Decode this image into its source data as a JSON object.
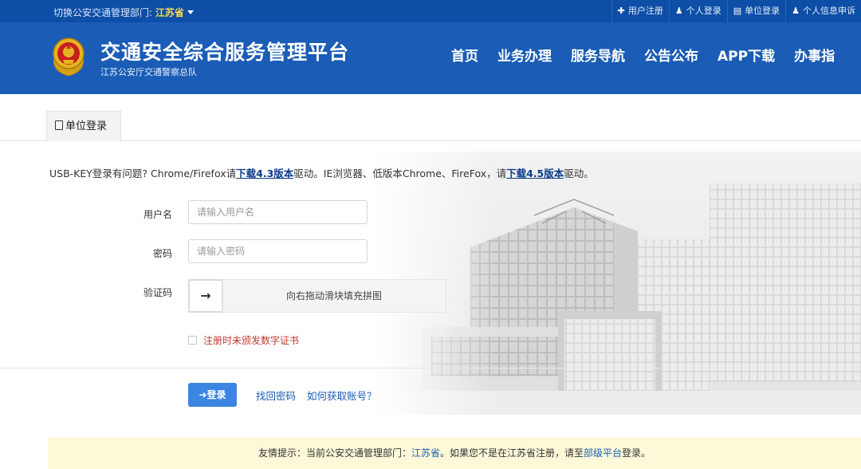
{
  "topbar": {
    "dept_prefix": "切换公安交通管理部门: ",
    "dept_name": "江苏省",
    "links": [
      {
        "icon": "plus-icon",
        "label": "用户注册"
      },
      {
        "icon": "person-icon",
        "label": "个人登录"
      },
      {
        "icon": "building-icon",
        "label": "单位登录"
      },
      {
        "icon": "person-icon",
        "label": "个人信息申诉"
      }
    ]
  },
  "header": {
    "title": "交通安全综合服务管理平台",
    "subtitle": "江苏公安厅交通警察总队",
    "nav": [
      "首页",
      "业务办理",
      "服务导航",
      "公告公布",
      "APP下载",
      "办事指"
    ]
  },
  "tab": {
    "label": "单位登录"
  },
  "notice": {
    "part1": "USB-KEY登录有问题? Chrome/Firefox请",
    "link1": "下载4.3版本",
    "part2": "驱动。IE浏览器、低版本Chrome、FireFox，请",
    "link2": "下载4.5版本",
    "part3": "驱动。"
  },
  "form": {
    "username_label": "用户名",
    "username_placeholder": "请输入用户名",
    "username_value": "",
    "password_label": "密码",
    "password_placeholder": "请输入密码",
    "password_value": "",
    "captcha_label": "验证码",
    "slider_arrow": "→",
    "slider_hint": "向右拖动滑块填充拼图",
    "cert_label": "注册时未颁发数字证书",
    "login_button": "登录",
    "login_icon": "➜",
    "forgot_password": "找回密码",
    "how_to_get_account": "如何获取账号？"
  },
  "tip": {
    "prefix": "友情提示：当前公安交通管理部门：",
    "dept": "江苏省",
    "middle": "。如果您不是在江苏省注册，请至",
    "link": "部级平台",
    "suffix": "登录。"
  },
  "colors": {
    "header_blue": "#1a5cb6",
    "topbar_blue": "#0d4ea6",
    "button_blue": "#3a86e0",
    "tip_bg": "#fcf8d8",
    "warning_red": "#c0392b"
  }
}
